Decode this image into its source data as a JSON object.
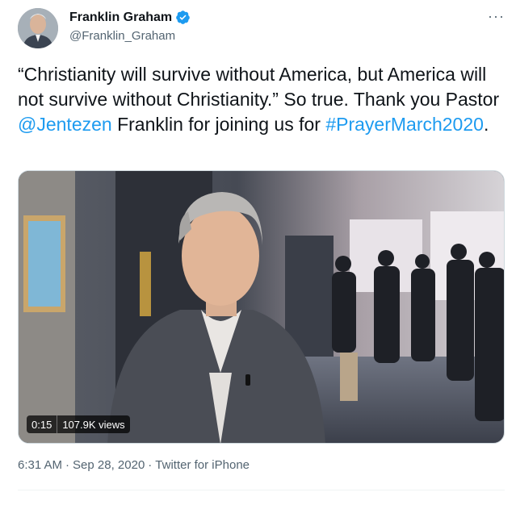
{
  "author": {
    "display_name": "Franklin Graham",
    "handle": "@Franklin_Graham",
    "verified": true,
    "avatar_icon": "profile-photo"
  },
  "menu_icon": "ellipsis-icon",
  "tweet": {
    "text_part1": "“Christianity will survive without America, but America will not survive without Christianity.” So true. Thank you Pastor ",
    "mention": "@Jentezen",
    "text_part2": " Franklin for joining us for ",
    "hashtag": "#PrayerMarch2020",
    "text_part3": "."
  },
  "video": {
    "duration": "0:15",
    "views": "107.9K views"
  },
  "meta": {
    "time": "6:31 AM",
    "date": "Sep 28, 2020",
    "source": "Twitter for iPhone",
    "dot": "·"
  },
  "colors": {
    "link": "#1d9bf0",
    "text": "#0f1419",
    "muted": "#536471",
    "verified": "#1d9bf0"
  }
}
